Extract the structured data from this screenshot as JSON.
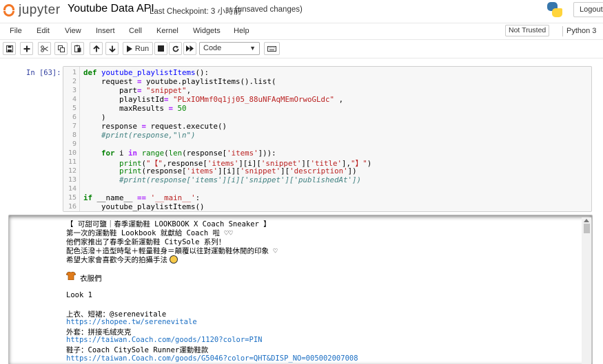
{
  "header": {
    "logo_text": "jupyter",
    "notebook_title": "Youtube Data API",
    "checkpoint": "Last Checkpoint: 3 小時前",
    "unsaved": "(unsaved changes)",
    "logout_label": "Logout"
  },
  "menubar": {
    "items": [
      "File",
      "Edit",
      "View",
      "Insert",
      "Cell",
      "Kernel",
      "Widgets",
      "Help"
    ],
    "trust_label": "Not Trusted",
    "kernel_name": "Python 3"
  },
  "toolbar": {
    "run_label": "Run",
    "cell_type": "Code"
  },
  "cell": {
    "prompt": "In [63]:",
    "line_numbers": [
      "1",
      "2",
      "3",
      "4",
      "5",
      "6",
      "7",
      "8",
      "9",
      "10",
      "11",
      "12",
      "13",
      "14",
      "15",
      "16"
    ],
    "code_lines": [
      "def youtube_playlistItems():",
      "    request = youtube.playlistItems().list(",
      "        part= \"snippet\",",
      "        playlistId= \"PLxIOMmf0q1jj05_88uNFAqMEmOrwoGLdc\" ,",
      "        maxResults = 50",
      "    )",
      "    response = request.execute()",
      "    #print(response,\"\\n\")",
      "",
      "    for i in range(len(response['items'])):",
      "        print(\"【\",response['items'][i]['snippet']['title'],\"】\")",
      "        print(response['items'][i]['snippet']['description'])",
      "        #print(response['items'][i]['snippet']['publishedAt'])",
      "",
      "if __name__ == '__main__':",
      "    youtube_playlistItems()"
    ]
  },
  "output": {
    "lines": [
      "【 可甜可鹽｜春季運動鞋 LOOKBOOK X Coach Sneaker 】",
      "第一次的運動鞋 Lookbook 就獻給 Coach 啦 ♡♡",
      "他們家推出了春季全新運動鞋 CitySole 系列！",
      "配色活潑＋造型時髦＋輕量鞋身＝顛覆以往對運動鞋休閒的印象 ♡",
      "希望大家會喜歡今天的拍攝手法",
      "",
      "衣服們",
      "",
      "Look 1",
      "",
      "上衣、短裙：@serenevitale",
      "https://shopee.tw/serenevitale",
      "外套：拼接毛絨夾克",
      "https://taiwan.Coach.com/goods/1120?color=PIN",
      "鞋子：Coach CitySole Runner運動鞋款",
      "https://taiwan.Coach.com/goods/G5046?color=QHT&DISP_NO=005002007008"
    ]
  }
}
